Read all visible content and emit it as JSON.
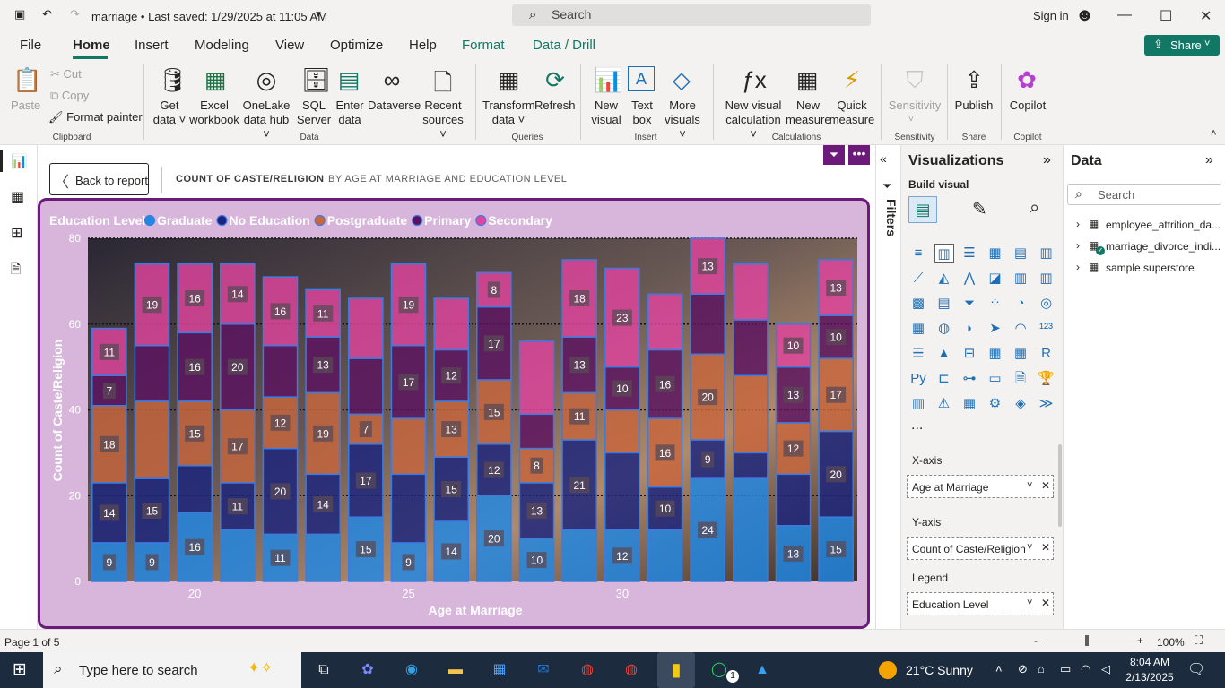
{
  "titlebar": {
    "doc_title": "marriage • Last saved: 1/29/2025 at 11:05 AM",
    "search_placeholder": "Search",
    "sign_in": "Sign in"
  },
  "tabs": [
    "File",
    "Home",
    "Insert",
    "Modeling",
    "View",
    "Optimize",
    "Help",
    "Format",
    "Data / Drill"
  ],
  "share_label": "Share",
  "ribbon": {
    "clipboard": {
      "paste": "Paste",
      "cut": "Cut",
      "copy": "Copy",
      "format_painter": "Format painter",
      "group": "Clipboard"
    },
    "data": {
      "items": [
        {
          "l1": "Get",
          "l2": "data ˅",
          "icon": "database-icon"
        },
        {
          "l1": "Excel",
          "l2": "workbook",
          "icon": "excel-icon"
        },
        {
          "l1": "OneLake",
          "l2": "data hub ˅",
          "icon": "onelake-icon"
        },
        {
          "l1": "SQL",
          "l2": "Server",
          "icon": "sql-server-icon"
        },
        {
          "l1": "Enter",
          "l2": "data",
          "icon": "table-icon"
        },
        {
          "l1": "Dataverse",
          "l2": "",
          "icon": "dataverse-icon"
        },
        {
          "l1": "Recent",
          "l2": "sources ˅",
          "icon": "recent-sources-icon"
        }
      ],
      "group": "Data"
    },
    "queries": {
      "transform_l1": "Transform",
      "transform_l2": "data ˅",
      "refresh": "Refresh",
      "group": "Queries"
    },
    "insert": {
      "new_visual_l1": "New",
      "new_visual_l2": "visual",
      "text_box_l1": "Text",
      "text_box_l2": "box",
      "more_l1": "More",
      "more_l2": "visuals ˅",
      "group": "Insert"
    },
    "calculations": {
      "nvc_l1": "New visual",
      "nvc_l2": "calculation ˅",
      "nm_l1": "New",
      "nm_l2": "measure",
      "qm_l1": "Quick",
      "qm_l2": "measure",
      "group": "Calculations"
    },
    "sensitivity": {
      "label": "Sensitivity",
      "group": "Sensitivity"
    },
    "share": {
      "publish": "Publish",
      "group": "Share"
    },
    "copilot": {
      "label": "Copilot",
      "group": "Copilot"
    }
  },
  "focus": {
    "back_label": "Back to report",
    "title": "COUNT OF CASTE/RELIGION",
    "subtitle": "BY AGE AT MARRIAGE AND EDUCATION LEVEL"
  },
  "filters_label": "Filters",
  "viz": {
    "title": "Visualizations",
    "build_visual": "Build visual",
    "more": "...",
    "wells": [
      {
        "label": "X-axis",
        "value": "Age at Marriage"
      },
      {
        "label": "Y-axis",
        "value": "Count of Caste/Religion"
      },
      {
        "label": "Legend",
        "value": "Education Level"
      }
    ]
  },
  "data_pane": {
    "title": "Data",
    "search_placeholder": "Search",
    "tables": [
      "employee_attrition_da...",
      "marriage_divorce_indi...",
      "sample superstore"
    ]
  },
  "status": {
    "page": "Page 1 of 5",
    "zoom": "100%"
  },
  "taskbar": {
    "search_placeholder": "Type here to search",
    "weather": "21°C  Sunny",
    "time": "8:04 AM",
    "date": "2/13/2025",
    "whatsapp_badge": "1"
  },
  "chart_data": {
    "type": "bar",
    "stacked": true,
    "legend_title": "Education Level",
    "legend_position": "top-left",
    "xlabel": "Age at Marriage",
    "ylabel": "Count of Caste/Religion",
    "ylim": [
      0,
      80
    ],
    "yticks": [
      0,
      20,
      40,
      60,
      80
    ],
    "xticks": [
      20,
      25,
      30
    ],
    "categories": [
      18,
      19,
      20,
      21,
      22,
      23,
      24,
      25,
      26,
      27,
      28,
      29,
      30,
      31,
      32,
      33,
      34,
      35
    ],
    "series": [
      {
        "name": "Graduate",
        "color": "#1e88e5",
        "values": [
          9,
          9,
          16,
          12,
          11,
          11,
          15,
          9,
          14,
          20,
          10,
          12,
          12,
          12,
          24,
          24,
          13,
          15
        ],
        "labels": [
          "9",
          "9",
          "16",
          "",
          "11",
          "",
          "15",
          "9",
          "14",
          "20",
          "10",
          "",
          "12",
          "",
          "24",
          "",
          "13",
          "15"
        ]
      },
      {
        "name": "No Education",
        "color": "#1a237e",
        "values": [
          14,
          15,
          11,
          11,
          20,
          14,
          17,
          16,
          15,
          12,
          13,
          21,
          18,
          10,
          9,
          6,
          12,
          20
        ],
        "labels": [
          "14",
          "15",
          "",
          "11",
          "20",
          "14",
          "17",
          "",
          "15",
          "12",
          "13",
          "21",
          "",
          "10",
          "9",
          "",
          "",
          "20"
        ]
      },
      {
        "name": "Postgraduate",
        "color": "#c8673d",
        "values": [
          18,
          18,
          15,
          17,
          12,
          19,
          7,
          13,
          13,
          15,
          8,
          11,
          10,
          16,
          20,
          18,
          12,
          17
        ],
        "labels": [
          "18",
          "",
          "15",
          "17",
          "12",
          "19",
          "7",
          "",
          "13",
          "15",
          "8",
          "11",
          "",
          "16",
          "20",
          "",
          "12",
          "17"
        ]
      },
      {
        "name": "Primary",
        "color": "#5c1260",
        "values": [
          7,
          13,
          16,
          20,
          12,
          13,
          13,
          17,
          12,
          17,
          8,
          13,
          10,
          16,
          14,
          13,
          13,
          10
        ],
        "labels": [
          "7",
          "",
          "16",
          "20",
          "",
          "13",
          "",
          "17",
          "12",
          "17",
          "",
          "13",
          "10",
          "16",
          "",
          "",
          "13",
          "10"
        ]
      },
      {
        "name": "Secondary",
        "color": "#e0449e",
        "values": [
          11,
          19,
          16,
          14,
          16,
          11,
          14,
          19,
          12,
          8,
          17,
          18,
          23,
          13,
          13,
          13,
          10,
          13
        ],
        "labels": [
          "11",
          "19",
          "16",
          "14",
          "16",
          "11",
          "",
          "19",
          "",
          "8",
          "",
          "18",
          "23",
          "",
          "13",
          "",
          "10",
          "13"
        ]
      }
    ]
  },
  "colors": {
    "accent": "#117865",
    "frame": "#6b1a7a",
    "frame_bg": "#d8b6dc"
  }
}
